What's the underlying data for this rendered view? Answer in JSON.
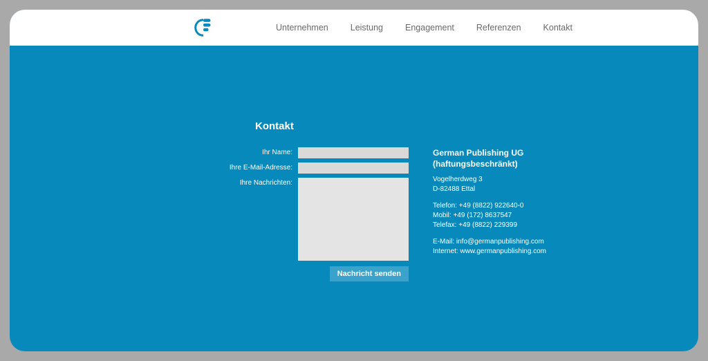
{
  "nav": {
    "items": [
      {
        "label": "Unternehmen"
      },
      {
        "label": "Leistung"
      },
      {
        "label": "Engagement"
      },
      {
        "label": "Referenzen"
      },
      {
        "label": "Kontakt"
      }
    ]
  },
  "page": {
    "title": "Kontakt"
  },
  "form": {
    "name_label": "Ihr Name:",
    "email_label": "Ihre E-Mail-Adresse:",
    "message_label": "Ihre Nachrichten:",
    "name_value": "",
    "email_value": "",
    "message_value": "",
    "submit_label": "Nachricht senden"
  },
  "company": {
    "name_line1": "German Publishing UG",
    "name_line2": "(haftungsbeschränkt)",
    "address_line1": "Vogelherdweg 3",
    "address_line2": "D-82488 Ettal",
    "telefon": "Telefon: +49 (8822) 922640-0",
    "mobil": "Mobil: +49 (172) 8637547",
    "telefax": "Telefax: +49 (8822) 229399",
    "email": "E-Mail: info@germanpublishing.com",
    "internet": "Internet: www.germanpublishing.com"
  }
}
